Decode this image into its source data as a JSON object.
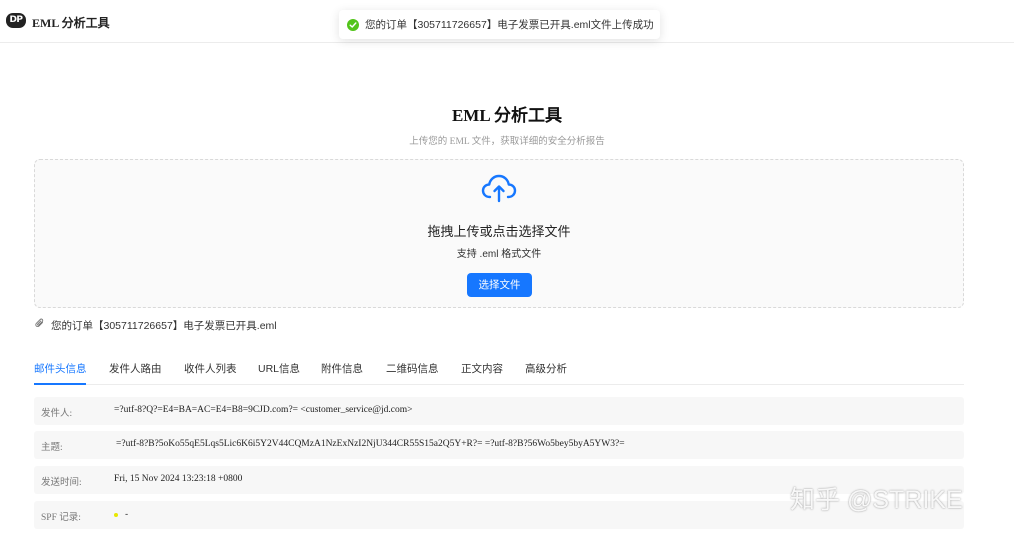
{
  "header": {
    "logo_text": "DP",
    "app_title": "EML 分析工具"
  },
  "toast": {
    "message": "您的订单【305711726657】电子发票已开具.eml文件上传成功",
    "icon": "check-circle-icon",
    "color": "#52c41a"
  },
  "hero": {
    "title": "EML 分析工具",
    "subtitle": "上传您的 EML 文件，获取详细的安全分析报告"
  },
  "upload": {
    "icon": "cloud-upload-icon",
    "title": "拖拽上传或点击选择文件",
    "hint": "支持 .eml 格式文件",
    "button_label": "选择文件",
    "accent": "#1677ff"
  },
  "file": {
    "icon": "paperclip-icon",
    "name": "您的订单【305711726657】电子发票已开具.eml"
  },
  "tabs": [
    {
      "label": "邮件头信息",
      "active": true
    },
    {
      "label": "发件人路由"
    },
    {
      "label": "收件人列表"
    },
    {
      "label": "URL信息"
    },
    {
      "label": "附件信息"
    },
    {
      "label": "二维码信息"
    },
    {
      "label": "正文内容"
    },
    {
      "label": "高级分析"
    }
  ],
  "header_info": [
    {
      "label": "发件人:",
      "value": "=?utf-8?Q?=E4=BA=AC=E4=B8=9CJD.com?= <customer_service@jd.com>"
    },
    {
      "label": "主题:",
      "value": "=?utf-8?B?5oKo55qE5Lqs5Lic6K6i5Y2V44CQMzA1NzExNzI2NjU344CR55S15a2Q5Y+R?= =?utf-8?B?56Wo5bey5byA5YW3?="
    },
    {
      "label": "发送时间:",
      "value": "Fri, 15 Nov 2024 13:23:18 +0800"
    },
    {
      "label": "SPF 记录:",
      "value": "-",
      "status_color": "#e8e800"
    }
  ],
  "watermark": "知乎 @STRIKE"
}
